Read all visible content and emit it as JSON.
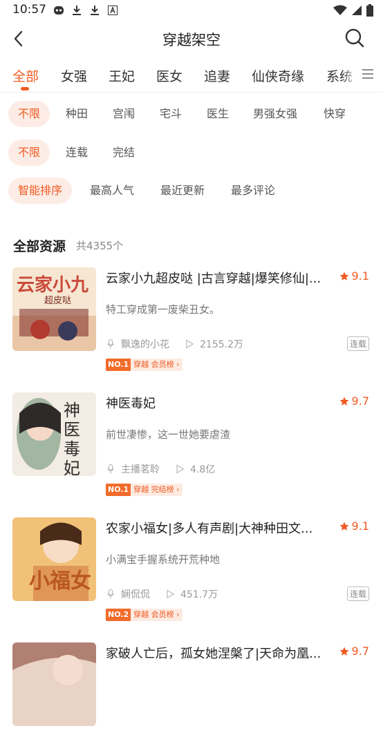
{
  "status_bar": {
    "time": "10:57"
  },
  "header": {
    "title": "穿越架空"
  },
  "categories": [
    "全部",
    "女强",
    "王妃",
    "医女",
    "追妻",
    "仙侠奇缘",
    "系统"
  ],
  "filters": {
    "row1": [
      "不限",
      "种田",
      "宫闱",
      "宅斗",
      "医生",
      "男强女强",
      "快穿"
    ],
    "row2": [
      "不限",
      "连载",
      "完结"
    ],
    "row3": [
      "智能排序",
      "最高人气",
      "最近更新",
      "最多评论"
    ]
  },
  "section": {
    "title": "全部资源",
    "count": "共4355个"
  },
  "books": [
    {
      "title": "云家小九超皮哒 |古言穿越|爆笑修仙|...",
      "rating": "9.1",
      "desc": "特工穿成第一废柴丑女。",
      "anchor": "飘逸的小花",
      "plays": "2155.2万",
      "status": "连载",
      "rank_no": "NO.1",
      "rank_text": "穿越 会员榜 ›",
      "cover_text": "云家小九",
      "cover_sub": "超皮哒",
      "cover_colors": [
        "#f6e6d2",
        "#c94a3a"
      ]
    },
    {
      "title": "神医毒妃",
      "rating": "9.7",
      "desc": "前世凄惨，这一世她要虐渣",
      "anchor": "主播茗聆",
      "plays": "4.8亿",
      "status": "",
      "rank_no": "NO.1",
      "rank_text": "穿越 完结榜 ›",
      "cover_text": "神医毒妃",
      "cover_sub": "",
      "cover_colors": [
        "#f3ece4",
        "#2e2a28"
      ]
    },
    {
      "title": "农家小福女|多人有声剧|大神种田文...",
      "rating": "9.1",
      "desc": "小满宝手握系统开荒种地",
      "anchor": "娴侃侃",
      "plays": "451.7万",
      "status": "连载",
      "rank_no": "NO.2",
      "rank_text": "穿越 会员榜 ›",
      "cover_text": "小福女",
      "cover_sub": "",
      "cover_colors": [
        "#f1c178",
        "#b8571f"
      ]
    },
    {
      "title": "家破人亡后，孤女她涅槃了|天命为凰...",
      "rating": "9.7",
      "desc": "",
      "anchor": "",
      "plays": "",
      "status": "",
      "rank_no": "",
      "rank_text": "",
      "cover_text": "",
      "cover_sub": "",
      "cover_colors": [
        "#e9d3c6",
        "#8b4b3a"
      ]
    }
  ]
}
